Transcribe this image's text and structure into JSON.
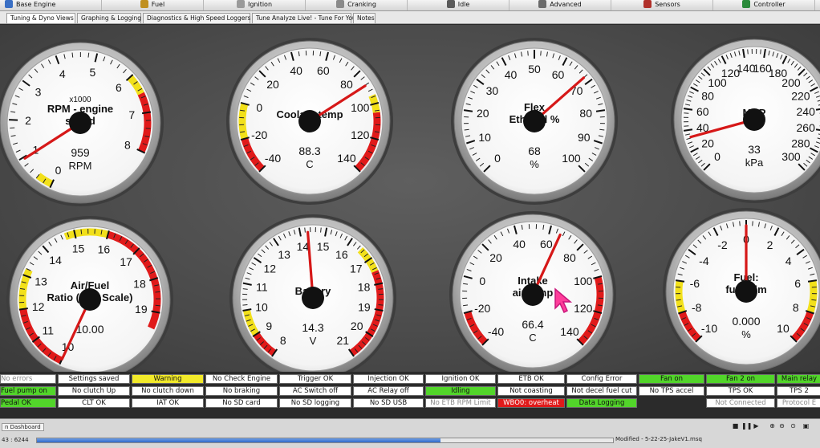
{
  "menu": [
    {
      "label": "Base Engine",
      "icon": "engine-icon",
      "color": "#3a6fc4"
    },
    {
      "label": "Fuel",
      "icon": "fuel-icon",
      "color": "#c09020"
    },
    {
      "label": "Ignition",
      "icon": "spark-plug-icon",
      "color": "#9a9a9a"
    },
    {
      "label": "Cranking",
      "icon": "cranking-icon",
      "color": "#8a8a8a"
    },
    {
      "label": "Idle",
      "icon": "idle-icon",
      "color": "#5a5a5a"
    },
    {
      "label": "Advanced",
      "icon": "advanced-gear-icon",
      "color": "#6a6a6a"
    },
    {
      "label": "Sensors",
      "icon": "sensors-icon",
      "color": "#b0302a"
    },
    {
      "label": "Controller",
      "icon": "controller-chip-icon",
      "color": "#2a8a3a"
    }
  ],
  "tabs": [
    {
      "label": "Tuning & Dyno Views",
      "active": true
    },
    {
      "label": "Graphing & Logging",
      "active": false
    },
    {
      "label": "Diagnostics & High Speed Loggers",
      "active": false
    },
    {
      "label": "Tune Analyze Live! - Tune For You",
      "active": false
    },
    {
      "label": "Notes",
      "active": false
    }
  ],
  "gauges": [
    {
      "title": [
        "RPM - engine",
        "speed"
      ],
      "multiplier": "x1000",
      "value_text": "959",
      "units": "RPM",
      "value": 0.959,
      "min": 0,
      "max": 8,
      "major": [
        0,
        1,
        2,
        3,
        4,
        5,
        6,
        7,
        8
      ],
      "start_deg": 205,
      "sweep_deg": 270,
      "low_warn": [
        0,
        0.4
      ],
      "low_crit": [],
      "high_warn": [
        6,
        6.5
      ],
      "high_crit": [
        6.5,
        8
      ]
    },
    {
      "title": [
        "Coolant temp"
      ],
      "value_text": "88.3",
      "units": "C",
      "value": 88.3,
      "min": -40,
      "max": 140,
      "major": [
        -40,
        -20,
        0,
        20,
        40,
        60,
        80,
        100,
        120,
        140
      ],
      "start_deg": 225,
      "sweep_deg": 270,
      "low_warn": [
        -20,
        0
      ],
      "low_crit": [
        -40,
        -20
      ],
      "high_warn": [
        95,
        105
      ],
      "high_crit": [
        105,
        140
      ]
    },
    {
      "title": [
        "Flex",
        "Ethanol %"
      ],
      "value_text": "68",
      "units": "%",
      "value": 68,
      "min": 0,
      "max": 100,
      "major": [
        0,
        10,
        20,
        30,
        40,
        50,
        60,
        70,
        80,
        90,
        100
      ],
      "start_deg": 225,
      "sweep_deg": 270,
      "low_warn": [],
      "low_crit": [],
      "high_warn": [],
      "high_crit": []
    },
    {
      "title": [
        "MAP"
      ],
      "value_text": "33",
      "units": "kPa",
      "value": 33,
      "min": 0,
      "max": 300,
      "major": [
        0,
        20,
        40,
        60,
        80,
        100,
        120,
        140,
        160,
        180,
        200,
        220,
        240,
        260,
        280,
        300
      ],
      "start_deg": 225,
      "sweep_deg": 270,
      "low_warn": [],
      "low_crit": [],
      "high_warn": [],
      "high_crit": []
    },
    {
      "title": [
        "Air/Fuel",
        "Ratio (Gas Scale)"
      ],
      "value_text": "10.00",
      "units": "",
      "value": 10.0,
      "min": 10,
      "max": 19.5,
      "major": [
        10,
        11,
        12,
        13,
        14,
        15,
        16,
        17,
        18,
        19
      ],
      "start_deg": 205,
      "sweep_deg": 270,
      "low_warn": [
        12,
        13.2
      ],
      "low_crit": [
        10,
        12
      ],
      "high_warn": [
        14.7,
        16
      ],
      "high_crit": [
        16,
        19.5
      ]
    },
    {
      "title": [
        "Battery"
      ],
      "value_text": "14.3",
      "units": "V",
      "value": 14.3,
      "min": 8,
      "max": 21,
      "major": [
        8,
        9,
        10,
        11,
        12,
        13,
        14,
        15,
        16,
        17,
        18,
        19,
        20,
        21
      ],
      "start_deg": 215,
      "sweep_deg": 290,
      "low_warn": [
        9,
        10
      ],
      "low_crit": [
        8,
        9
      ],
      "high_warn": [
        16.5,
        17.5
      ],
      "high_crit": [
        17.5,
        21
      ]
    },
    {
      "title": [
        "Intake",
        "air temp"
      ],
      "value_text": "66.4",
      "units": "C",
      "value": 66.4,
      "min": -40,
      "max": 140,
      "major": [
        -40,
        -20,
        0,
        20,
        40,
        60,
        80,
        100,
        120,
        140
      ],
      "start_deg": 225,
      "sweep_deg": 270,
      "low_warn": [],
      "low_crit": [
        -40,
        -20
      ],
      "high_warn": [],
      "high_crit": [
        100,
        140
      ]
    },
    {
      "title": [
        "Fuel:",
        "fuel trim"
      ],
      "value_text": "0.000",
      "units": "%",
      "value": 0,
      "min": -10,
      "max": 10,
      "major": [
        -10,
        -8,
        -6,
        -4,
        -2,
        0,
        2,
        4,
        6,
        8,
        10
      ],
      "start_deg": 225,
      "sweep_deg": 270,
      "low_warn": [
        -8,
        -6
      ],
      "low_crit": [
        -10,
        -8
      ],
      "high_warn": [
        6,
        8
      ],
      "high_crit": [
        8,
        10
      ]
    }
  ],
  "indicators": [
    [
      "No errors",
      "Fuel pump on",
      "Pedal OK"
    ],
    [
      "Settings saved",
      "No clutch Up",
      "CLT OK"
    ],
    [
      "Warning",
      "No clutch down",
      "IAT OK"
    ],
    [
      "No Check Engine",
      "No braking",
      "No SD card"
    ],
    [
      "Trigger OK",
      "AC Switch off",
      "No SD logging"
    ],
    [
      "Injection OK",
      "AC Relay off",
      "No SD USB"
    ],
    [
      "Ignition OK",
      "Idling",
      "No ETB RPM Limit"
    ],
    [
      "ETB OK",
      "Not coasting",
      "WBO0: overheat"
    ],
    [
      "Config Error",
      "Not decel fuel cut",
      "Data Logging"
    ],
    [
      "Fan on",
      "No TPS accel",
      ""
    ],
    [
      "Fan 2 on",
      "TPS OK",
      "Not Connected"
    ],
    [
      "Main relay",
      "TPS 2",
      "Protocol E"
    ]
  ],
  "indicator_states": [
    [
      "grey",
      "green",
      "green"
    ],
    [
      "white",
      "white",
      "white"
    ],
    [
      "yellow",
      "white",
      "white"
    ],
    [
      "white",
      "white",
      "white"
    ],
    [
      "white",
      "white",
      "white"
    ],
    [
      "white",
      "white",
      "white"
    ],
    [
      "white",
      "green",
      "grey"
    ],
    [
      "white",
      "white",
      "red"
    ],
    [
      "white",
      "white",
      "green"
    ],
    [
      "green",
      "white",
      "none"
    ],
    [
      "green",
      "white",
      "grey"
    ],
    [
      "green",
      "white",
      "grey"
    ]
  ],
  "status": {
    "tab_label": "n Dashboard",
    "counter": "43 : 6244",
    "file": "Modified - 5-22-25-JakeV1.msq",
    "progress": 0.7
  },
  "colors": {
    "warn": "#f2e01a",
    "crit": "#e01a1a",
    "needle": "#d61818",
    "indicator_green": "#52d52a",
    "indicator_yellow": "#f2ea2a",
    "indicator_red": "#e01a1a"
  }
}
